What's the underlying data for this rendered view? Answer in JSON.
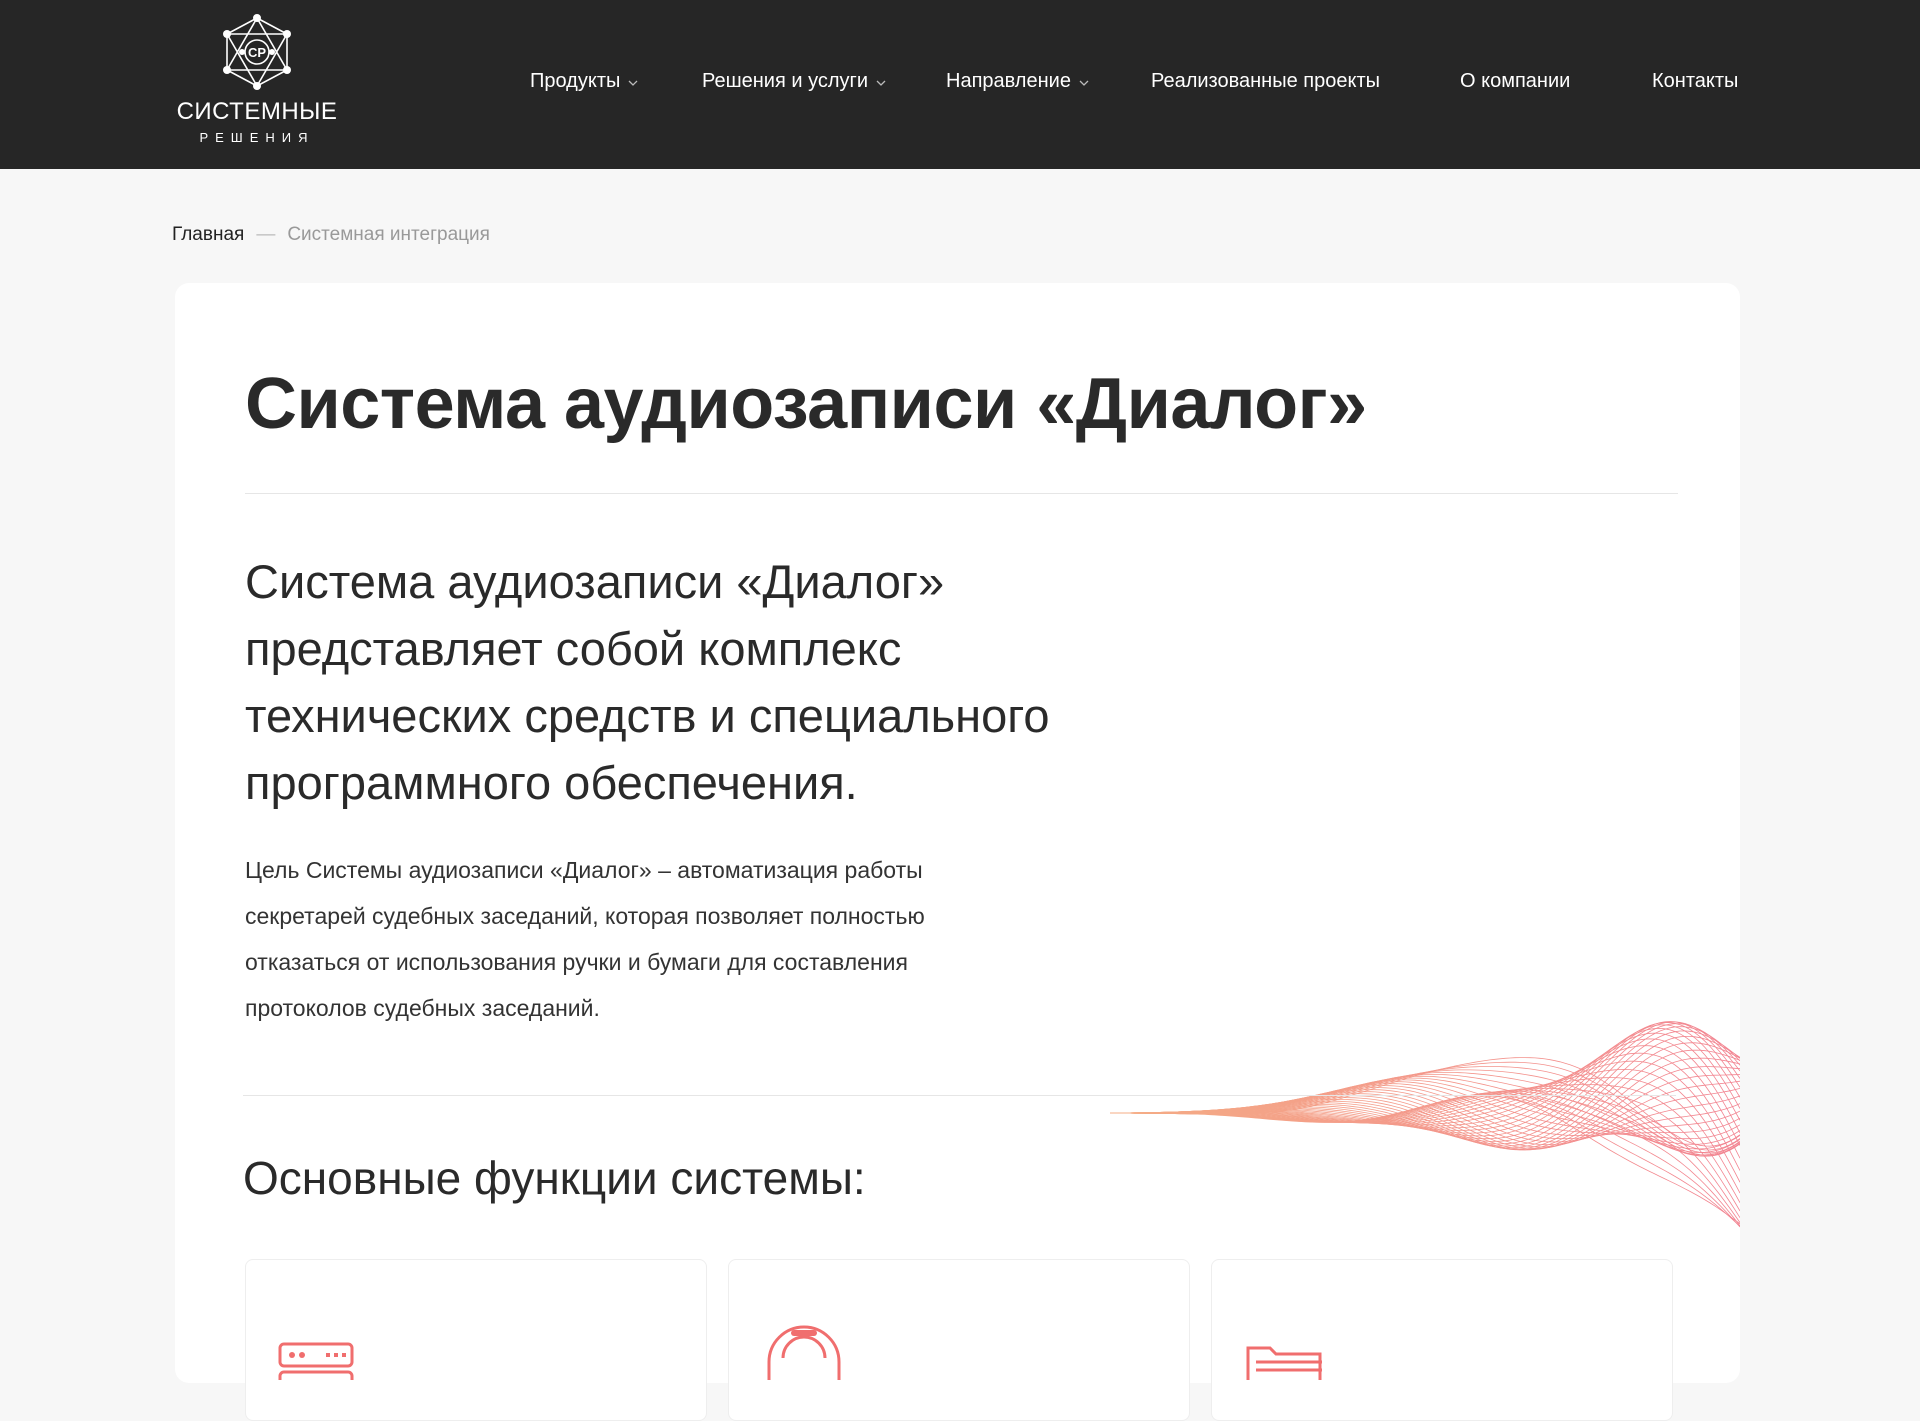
{
  "header": {
    "logo": {
      "monogram": "СР",
      "line1": "СИСТЕМНЫЕ",
      "line2": "РЕШЕНИЯ"
    },
    "nav": [
      {
        "label": "Продукты",
        "has_dropdown": true
      },
      {
        "label": "Решения и услуги",
        "has_dropdown": true
      },
      {
        "label": "Направление",
        "has_dropdown": true
      },
      {
        "label": "Реализованные проекты",
        "has_dropdown": false
      },
      {
        "label": "О компании",
        "has_dropdown": false
      },
      {
        "label": "Контакты",
        "has_dropdown": false
      }
    ]
  },
  "breadcrumb": {
    "home": "Главная",
    "separator": "—",
    "current": "Системная интеграция"
  },
  "main": {
    "title": "Система аудиозаписи «Диалог»",
    "lead": "Система аудиозаписи «Диалог» представляет собой комплекс технических средств и специального программного обеспечения.",
    "body": "Цель Системы аудиозаписи «Диалог» – автоматизация работы секретарей судебных заседаний, которая позволяет полностью отказаться от использования ручки и бумаги для составления протоколов судебных заседаний.",
    "section_title": "Основные функции системы:",
    "features": [
      {
        "icon": "server-icon"
      },
      {
        "icon": "headset-icon"
      },
      {
        "icon": "folder-icon"
      }
    ]
  },
  "colors": {
    "header_bg": "#262626",
    "page_bg": "#f7f7f7",
    "accent": "#f06e6e",
    "wave_start": "#f4a070",
    "wave_end": "#f06e7e"
  }
}
